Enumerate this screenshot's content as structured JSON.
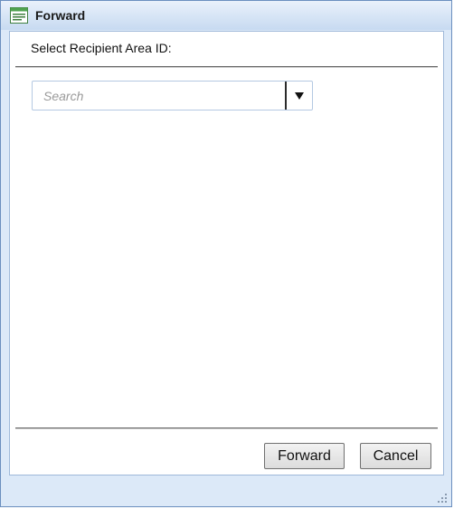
{
  "window": {
    "title": "Forward",
    "icon": "list-document-icon"
  },
  "form": {
    "prompt": "Select Recipient Area ID:",
    "search": {
      "placeholder": "Search",
      "value": ""
    }
  },
  "buttons": {
    "forward_label": "Forward",
    "cancel_label": "Cancel"
  },
  "colors": {
    "frame": "#dce9f8",
    "border": "#6b8fbf",
    "title_icon": "#3f9a3f"
  }
}
